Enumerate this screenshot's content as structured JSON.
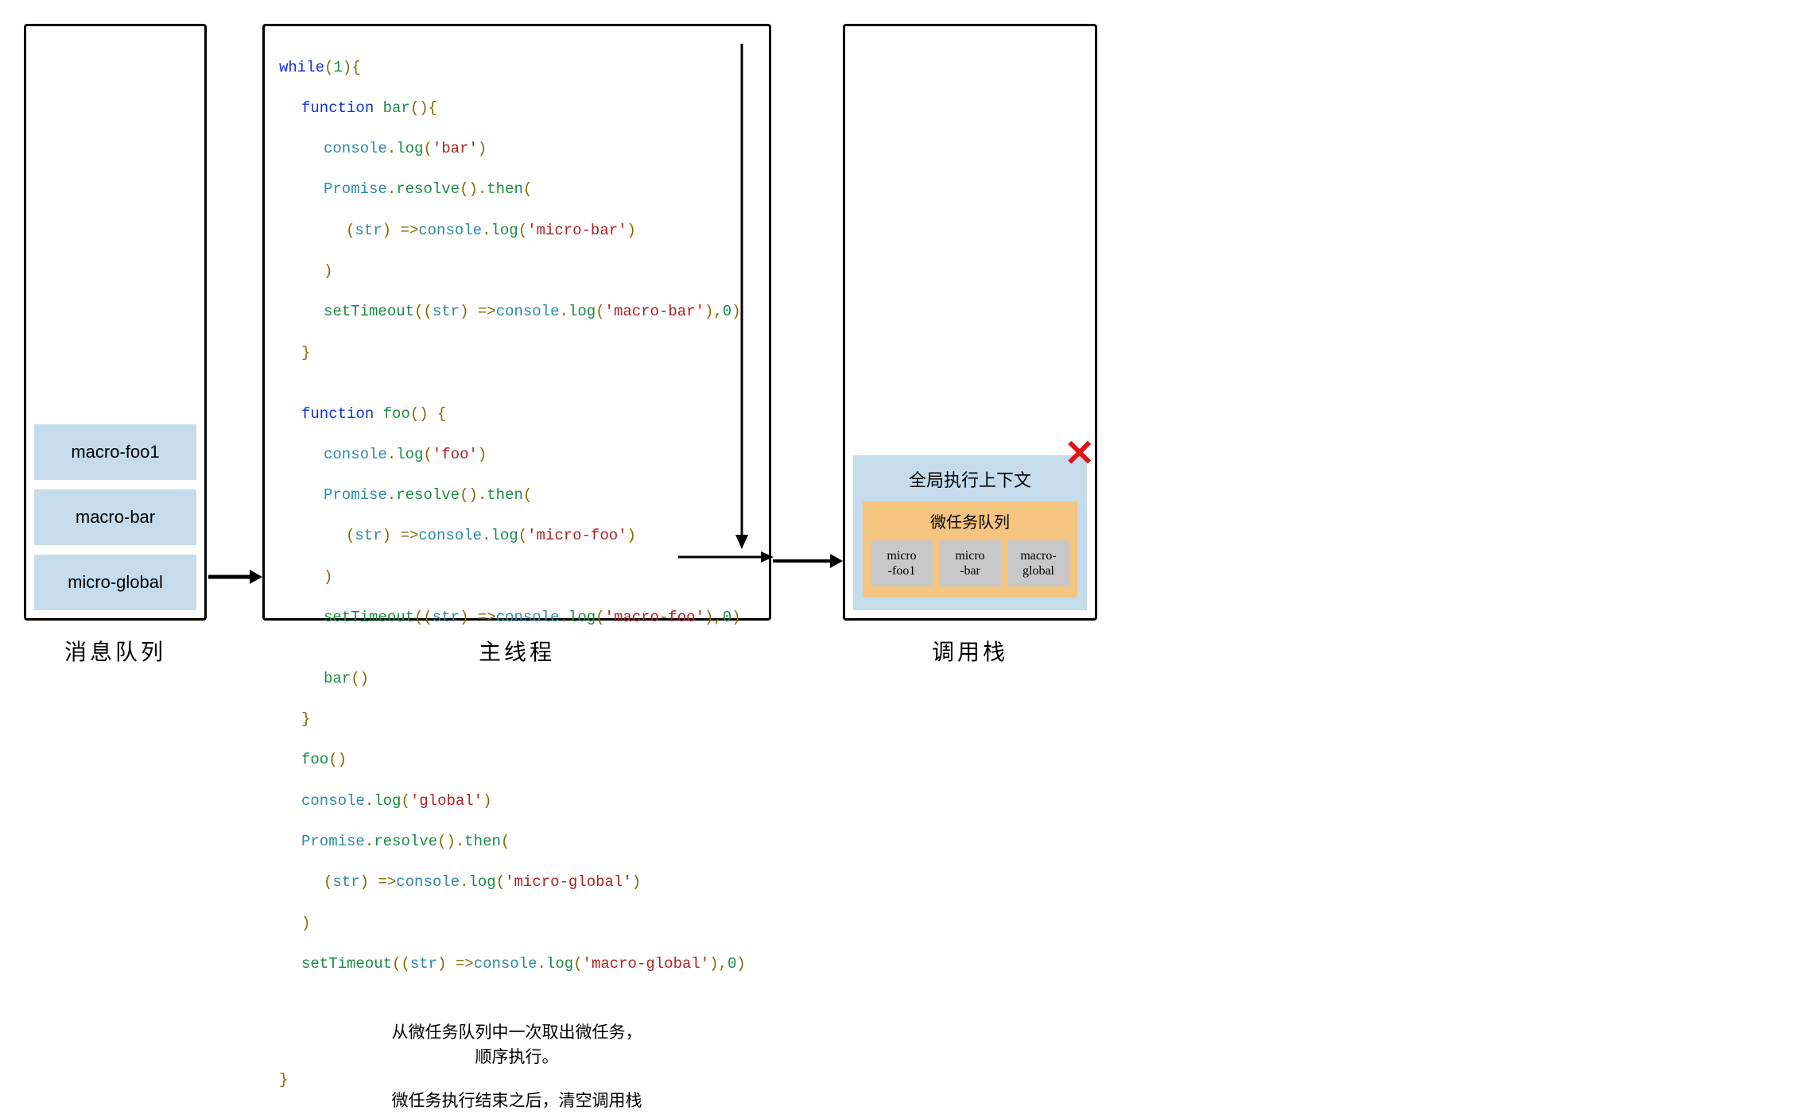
{
  "message_queue": {
    "caption": "消息队列",
    "items": [
      "macro-foo1",
      "macro-bar",
      "micro-global"
    ]
  },
  "main_thread": {
    "caption": "主线程",
    "while_open": "while(1){",
    "while_close": "}",
    "bar": {
      "decl": "function bar(){",
      "log": "console.log('bar')",
      "prom": "Promise.resolve().then(",
      "arrow_open": "(str) =>console.log('micro-bar')",
      "prom_close": ")",
      "timeout": "setTimeout((str) =>console.log('macro-bar'),0)",
      "close": "}"
    },
    "foo": {
      "decl": "function foo() {",
      "log": "console.log('foo')",
      "prom": "Promise.resolve().then(",
      "arrow_open": "(str) =>console.log('micro-foo')",
      "prom_close": ")",
      "timeout": "setTimeout((str) =>console.log('macro-foo'),0)",
      "bar_call": "bar()",
      "close": "}"
    },
    "global": {
      "foo_call": "foo()",
      "log": "console.log('global')",
      "prom": "Promise.resolve().then(",
      "arrow_open": "(str) =>console.log('micro-global')",
      "prom_close": ")",
      "timeout": "setTimeout((str) =>console.log('macro-global'),0)"
    },
    "annotation_line1": "从微任务队列中一次取出微任务，",
    "annotation_line2": "顺序执行。",
    "annotation_line3": "微任务执行结束之后，清空调用栈"
  },
  "call_stack": {
    "caption": "调用栈",
    "ctx_title": "全局执行上下文",
    "micro_queue_title": "微任务队列",
    "micro_items": [
      "micro-foo1",
      "micro-bar",
      "macro-global"
    ],
    "close_mark": "✕"
  }
}
